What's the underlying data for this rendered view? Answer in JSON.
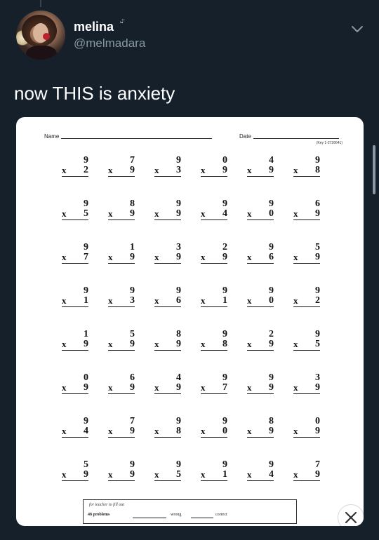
{
  "tweet": {
    "display_name": "melina",
    "verified_glyph": "ᵕ̈",
    "handle": "@melmadara",
    "text": "now THIS is anxiety"
  },
  "worksheet": {
    "name_label": "Name",
    "date_label": "Date",
    "key_text": "(Key 1-2726641)",
    "rows": [
      [
        [
          "9",
          "2"
        ],
        [
          "7",
          "9"
        ],
        [
          "9",
          "3"
        ],
        [
          "0",
          "9"
        ],
        [
          "4",
          "9"
        ],
        [
          "9",
          "8"
        ]
      ],
      [
        [
          "9",
          "5"
        ],
        [
          "8",
          "9"
        ],
        [
          "9",
          "9"
        ],
        [
          "9",
          "4"
        ],
        [
          "9",
          "0"
        ],
        [
          "6",
          "9"
        ]
      ],
      [
        [
          "9",
          "7"
        ],
        [
          "1",
          "9"
        ],
        [
          "3",
          "9"
        ],
        [
          "2",
          "9"
        ],
        [
          "9",
          "6"
        ],
        [
          "5",
          "9"
        ]
      ],
      [
        [
          "9",
          "1"
        ],
        [
          "9",
          "3"
        ],
        [
          "9",
          "6"
        ],
        [
          "9",
          "1"
        ],
        [
          "9",
          "0"
        ],
        [
          "9",
          "2"
        ]
      ],
      [
        [
          "1",
          "9"
        ],
        [
          "5",
          "9"
        ],
        [
          "8",
          "9"
        ],
        [
          "9",
          "8"
        ],
        [
          "2",
          "9"
        ],
        [
          "9",
          "5"
        ]
      ],
      [
        [
          "0",
          "9"
        ],
        [
          "6",
          "9"
        ],
        [
          "4",
          "9"
        ],
        [
          "9",
          "7"
        ],
        [
          "9",
          "9"
        ],
        [
          "3",
          "9"
        ]
      ],
      [
        [
          "9",
          "4"
        ],
        [
          "7",
          "9"
        ],
        [
          "9",
          "8"
        ],
        [
          "9",
          "0"
        ],
        [
          "8",
          "9"
        ],
        [
          "0",
          "9"
        ]
      ],
      [
        [
          "5",
          "9"
        ],
        [
          "9",
          "9"
        ],
        [
          "9",
          "5"
        ],
        [
          "9",
          "1"
        ],
        [
          "9",
          "4"
        ],
        [
          "7",
          "9"
        ]
      ]
    ],
    "times_sign": "x",
    "teacher_note": "for teacher to fill out",
    "problem_count": "48 problems",
    "wrong_label": "wrong",
    "correct_label": "correct"
  },
  "icons": {
    "menu": "chevron-down-icon",
    "close": "close-icon"
  },
  "colors": {
    "background": "#15202b",
    "secondary_text": "#8899a6"
  }
}
